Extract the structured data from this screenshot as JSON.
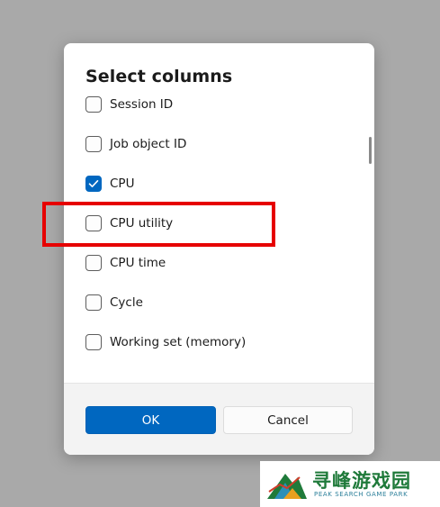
{
  "dialog": {
    "title": "Select columns",
    "options": [
      {
        "label": "Session ID",
        "checked": false
      },
      {
        "label": "Job object ID",
        "checked": false
      },
      {
        "label": "CPU",
        "checked": true
      },
      {
        "label": "CPU utility",
        "checked": false
      },
      {
        "label": "CPU time",
        "checked": false
      },
      {
        "label": "Cycle",
        "checked": false
      },
      {
        "label": "Working set (memory)",
        "checked": false
      }
    ],
    "ok_label": "OK",
    "cancel_label": "Cancel"
  },
  "colors": {
    "accent": "#0067c0",
    "highlight": "#e60000",
    "overlay": "#a9a9a9"
  },
  "watermark": {
    "title": "寻峰游戏园",
    "subtitle": "PEAK SEARCH GAME PARK"
  }
}
